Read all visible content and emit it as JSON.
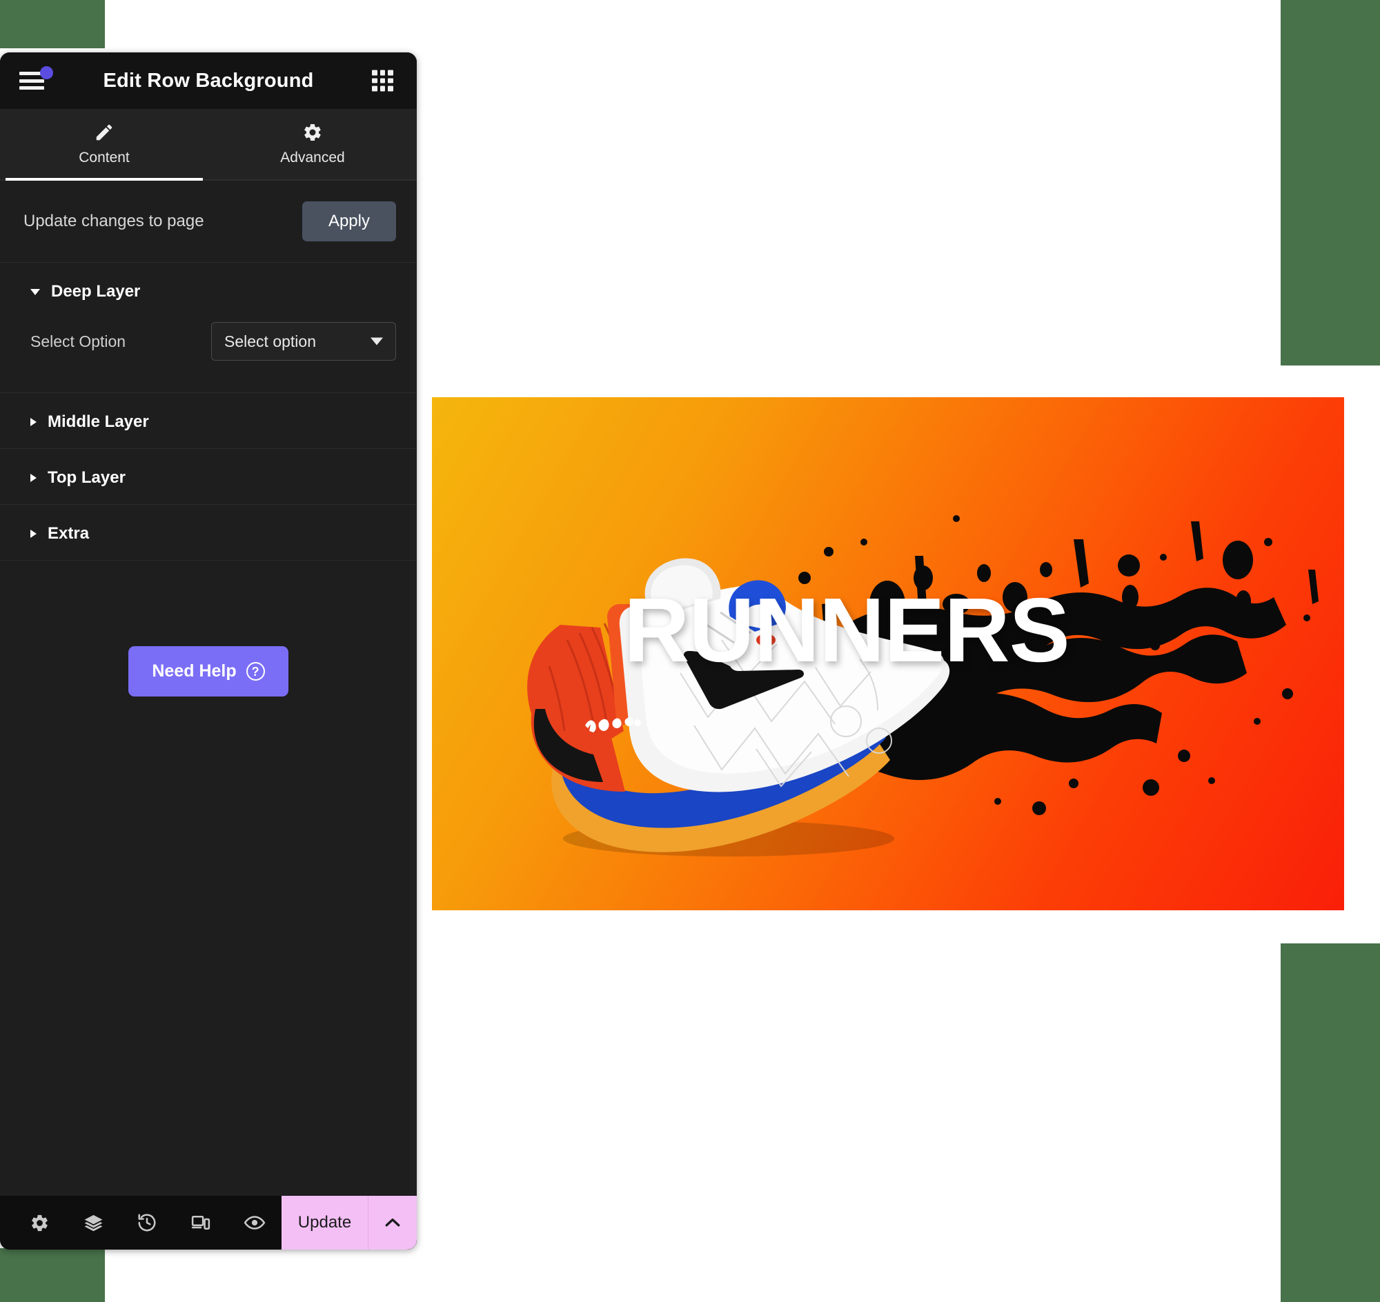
{
  "panel": {
    "header": {
      "title": "Edit Row Background",
      "menu_icon": "hamburger-icon",
      "grid_icon": "grid-apps-icon",
      "notification_dot_color": "#5b4de0"
    },
    "tabs": [
      {
        "label": "Content",
        "icon": "pencil-icon",
        "active": true
      },
      {
        "label": "Advanced",
        "icon": "gear-icon",
        "active": false
      }
    ],
    "apply_row": {
      "label": "Update changes to page",
      "button_label": "Apply",
      "button_color": "#4a5260"
    },
    "sections": [
      {
        "title": "Deep Layer",
        "expanded": true,
        "field_label": "Select Option",
        "select_value": "Select option"
      },
      {
        "title": "Middle Layer",
        "expanded": false
      },
      {
        "title": "Top Layer",
        "expanded": false
      },
      {
        "title": "Extra",
        "expanded": false
      }
    ],
    "help_button": {
      "label": "Need Help",
      "icon": "question-circle-icon",
      "color": "#7b6ef6"
    },
    "bottom_bar": {
      "icons": [
        "gear-icon",
        "layers-icon",
        "history-revisions-icon",
        "responsive-devices-icon",
        "preview-eye-icon"
      ],
      "update_label": "Update",
      "update_caret_icon": "chevron-up-icon",
      "update_color": "#f3bff5"
    }
  },
  "hero": {
    "headline": "RUNNERS",
    "gradient_start": "#f5b60d",
    "gradient_end": "#fa1f08",
    "splatter_color": "#0a0a0a",
    "shoe": {
      "upper_color": "#f2f2f2",
      "heel_color": "#e8401c",
      "midsole_color": "#1a45c4",
      "outsole_color": "#f0a22c",
      "swoosh_color": "#111111",
      "tongue_tab_color": "#1f4fd8"
    }
  },
  "decor": {
    "block_color": "#47724a"
  }
}
